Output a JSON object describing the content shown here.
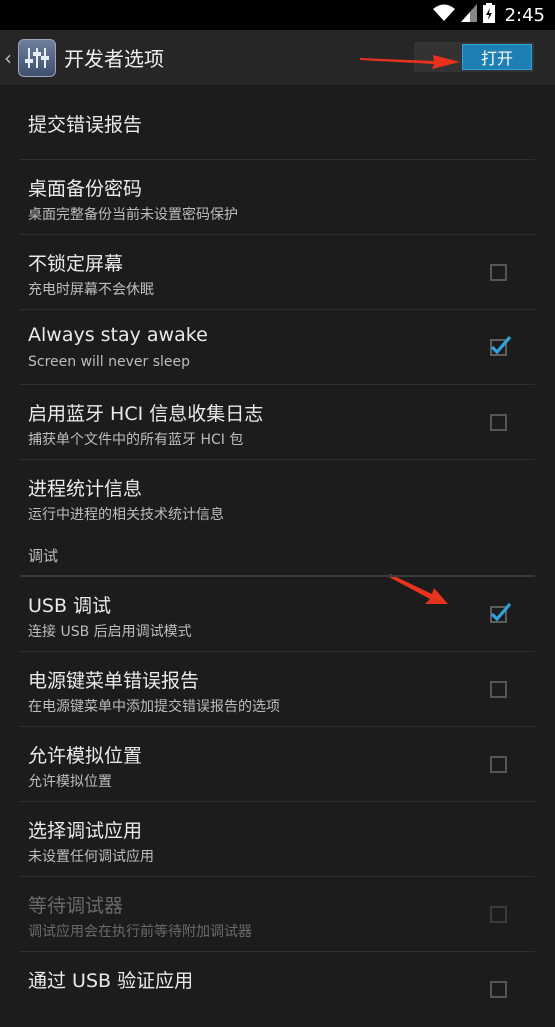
{
  "status_bar": {
    "time": "2:45",
    "icons": [
      "wifi-icon",
      "signal-icon",
      "battery-icon"
    ]
  },
  "action_bar": {
    "title": "开发者选项",
    "toggle_label": "打开"
  },
  "items": [
    {
      "title": "提交错误报告",
      "subtitle": ""
    },
    {
      "title": "桌面备份密码",
      "subtitle": "桌面完整备份当前未设置密码保护"
    },
    {
      "title": "不锁定屏幕",
      "subtitle": "充电时屏幕不会休眠",
      "checked": false
    },
    {
      "title": "Always stay awake",
      "subtitle": "Screen will never sleep",
      "checked": true
    },
    {
      "title": "启用蓝牙 HCI 信息收集日志",
      "subtitle": "捕获单个文件中的所有蓝牙 HCI 包",
      "checked": false
    },
    {
      "title": "进程统计信息",
      "subtitle": "运行中进程的相关技术统计信息"
    }
  ],
  "section_debug": {
    "label": "调试"
  },
  "debug_items": [
    {
      "title": "USB 调试",
      "subtitle": "连接 USB 后启用调试模式",
      "checked": true
    },
    {
      "title": "电源键菜单错误报告",
      "subtitle": "在电源键菜单中添加提交错误报告的选项",
      "checked": false
    },
    {
      "title": "允许模拟位置",
      "subtitle": "允许模拟位置",
      "checked": false
    },
    {
      "title": "选择调试应用",
      "subtitle": "未设置任何调试应用"
    },
    {
      "title": "等待调试器",
      "subtitle": "调试应用会在执行前等待附加调试器",
      "checked": false,
      "disabled": true
    },
    {
      "title": "通过 USB 验证应用",
      "subtitle": "",
      "checked": false
    }
  ],
  "colors": {
    "accent": "#2ea3dc",
    "annotation_arrow": "#e8321e",
    "background": "#1c1c1c"
  }
}
